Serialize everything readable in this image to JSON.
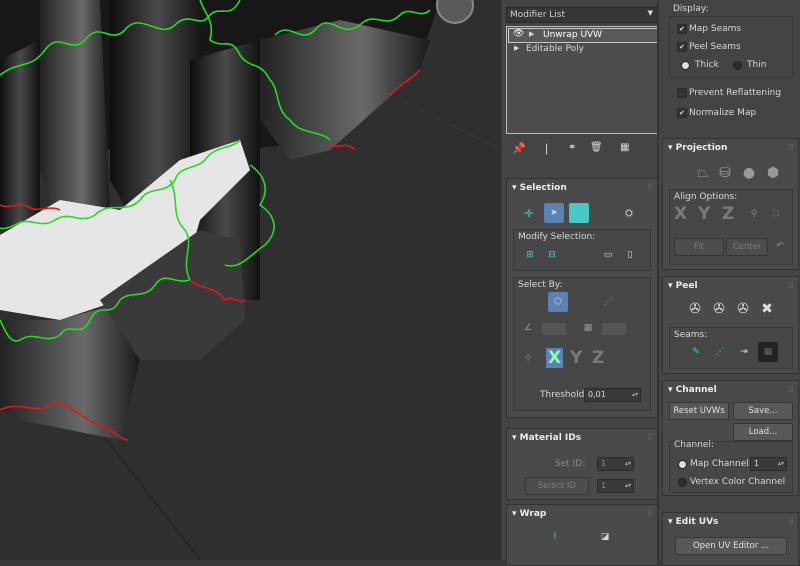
{
  "modifier": {
    "list_label": "Modifier List",
    "stack": [
      {
        "label": "Unwrap UVW"
      },
      {
        "label": "Editable Poly"
      }
    ]
  },
  "display": {
    "title": "Display:",
    "map_seams": "Map Seams",
    "peel_seams": "Peel Seams",
    "thick": "Thick",
    "thin": "Thin",
    "prevent_reflattening": "Prevent Reflattening",
    "normalize_map": "Normalize Map"
  },
  "selection": {
    "title": "Selection",
    "modify_selection": "Modify Selection:",
    "select_by": "Select By:",
    "threshold_label": "Threshold:",
    "threshold_value": "0,01",
    "axes": [
      "X",
      "Y",
      "Z"
    ]
  },
  "material_ids": {
    "title": "Material IDs",
    "set_id": "Set ID:",
    "set_id_value": "1",
    "select_id": "Select ID",
    "select_id_value": "1"
  },
  "wrap": {
    "title": "Wrap"
  },
  "projection": {
    "title": "Projection",
    "align_options": "Align Options:",
    "axes": [
      "X",
      "Y",
      "Z"
    ],
    "fit": "Fit",
    "center": "Center"
  },
  "peel": {
    "title": "Peel",
    "seams": "Seams:"
  },
  "channel": {
    "title": "Channel",
    "reset_uvws": "Reset UVWs",
    "save": "Save...",
    "load": "Load...",
    "channel_label": "Channel:",
    "map_channel": "Map Channel:",
    "map_channel_value": "1",
    "vertex_color_channel": "Vertex Color Channel"
  },
  "edit_uvs": {
    "title": "Edit UVs",
    "open_uv_editor": "Open UV Editor ..."
  },
  "colors": {
    "seam_green": "#22dd22",
    "seam_red": "#e01818",
    "active_blue": "#5b82b4",
    "teal": "#46c8c8"
  }
}
